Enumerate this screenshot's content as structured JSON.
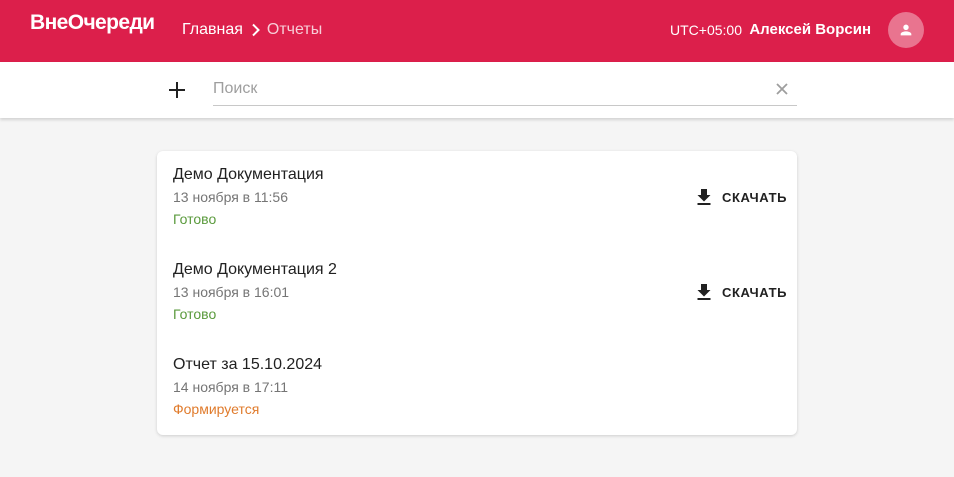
{
  "header": {
    "logo": "ВнеОчереди",
    "breadcrumb": {
      "home": "Главная",
      "current": "Отчеты"
    },
    "timezone": "UTC+05:00",
    "user_name": "Алексей Ворсин",
    "icons": {
      "separator": "chevron-right-icon",
      "avatar": "person-icon"
    }
  },
  "toolbar": {
    "add_icon": "plus-icon",
    "search": {
      "placeholder": "Поиск",
      "value": "",
      "clear_icon": "close-icon"
    }
  },
  "colors": {
    "brand": "#dc1f4b",
    "status_done": "#5a9a3c",
    "status_pending": "#e07b2c"
  },
  "reports": [
    {
      "title": "Демо Документация",
      "date": "13 ноября в 11:56",
      "status": "Готово",
      "status_type": "done",
      "download_label": "СКАЧАТЬ",
      "download_icon": "download-icon"
    },
    {
      "title": "Демо Документация 2",
      "date": "13 ноября в 16:01",
      "status": "Готово",
      "status_type": "done",
      "download_label": "СКАЧАТЬ",
      "download_icon": "download-icon"
    },
    {
      "title": "Отчет за 15.10.2024",
      "date": "14 ноября в 17:11",
      "status": "Формируется",
      "status_type": "pending"
    }
  ]
}
